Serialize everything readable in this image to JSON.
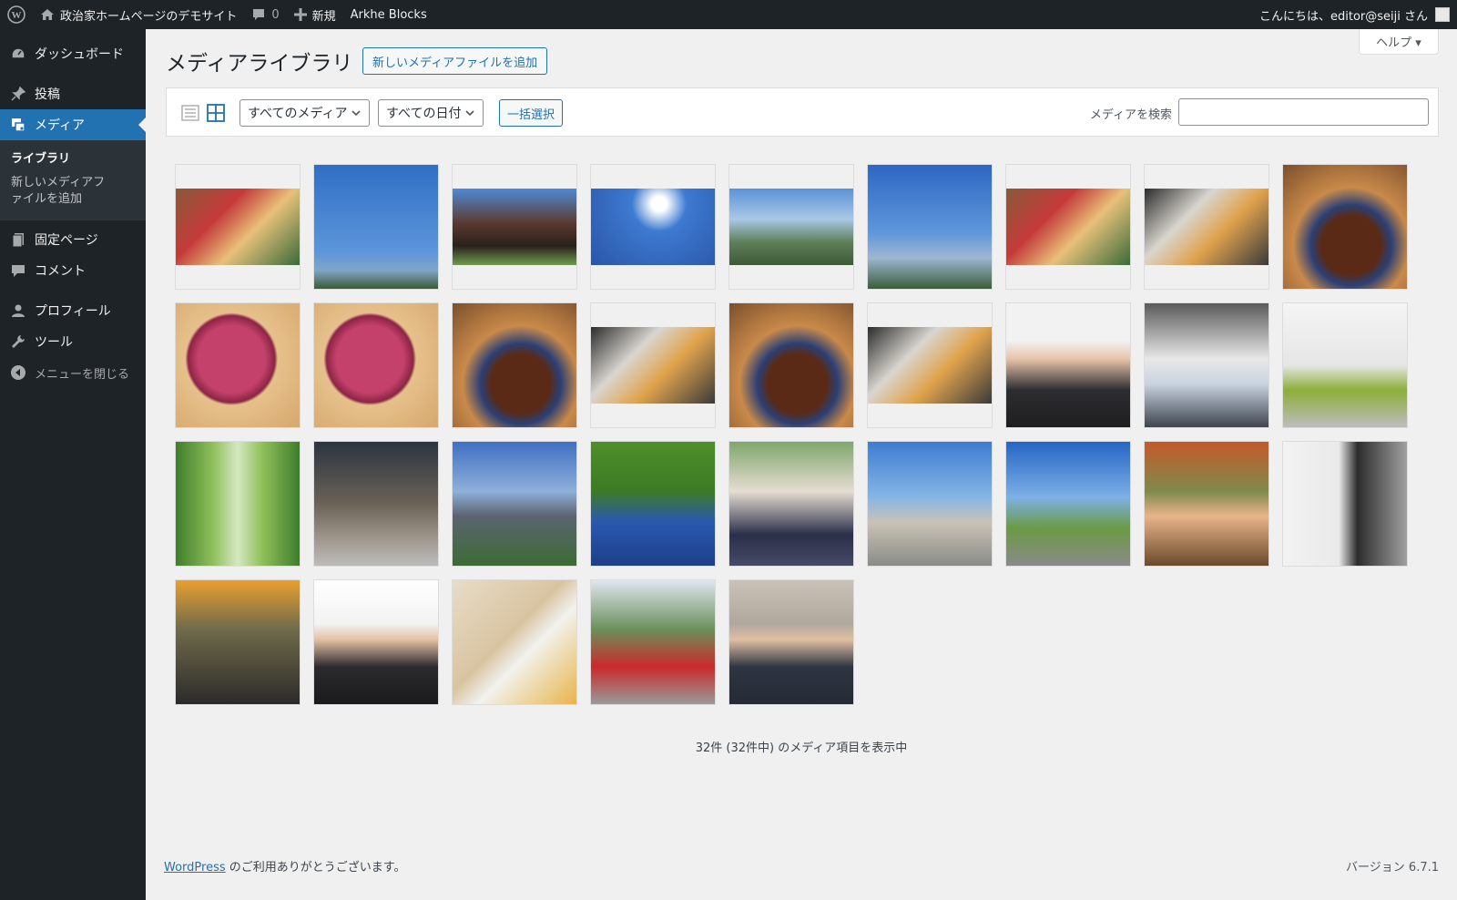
{
  "adminbar": {
    "site_name": "政治家ホームページのデモサイト",
    "comments_count": "0",
    "new_label": "新規",
    "theme_link": "Arkhe Blocks",
    "greeting": "こんにちは、editor@seiji さん"
  },
  "sidebar": {
    "items": [
      {
        "label": "ダッシュボード",
        "icon": "dashboard-icon"
      },
      {
        "label": "投稿",
        "icon": "pin-icon"
      },
      {
        "label": "メディア",
        "icon": "media-icon"
      },
      {
        "label": "固定ページ",
        "icon": "page-icon"
      },
      {
        "label": "コメント",
        "icon": "comment-icon"
      },
      {
        "label": "プロフィール",
        "icon": "user-icon"
      },
      {
        "label": "ツール",
        "icon": "wrench-icon"
      }
    ],
    "submenu": {
      "library": "ライブラリ",
      "add_new": "新しいメディアファイルを追加"
    },
    "collapse_label": "メニューを閉じる"
  },
  "header": {
    "title": "メディアライブラリ",
    "add_new_button": "新しいメディアファイルを追加",
    "help_label": "ヘルプ ▾"
  },
  "toolbar": {
    "type_filter": "すべてのメディア",
    "date_filter": "すべての日付",
    "bulk_select": "一括選択",
    "search_label": "メディアを検索",
    "search_value": ""
  },
  "media": [
    {
      "subject": "gift boxes",
      "fit": "band"
    },
    {
      "subject": "blue sky",
      "fit": "full"
    },
    {
      "subject": "curved monument",
      "fit": "band"
    },
    {
      "subject": "sun sculpture",
      "fit": "band"
    },
    {
      "subject": "mountain statues",
      "fit": "band"
    },
    {
      "subject": "sea of clouds",
      "fit": "full"
    },
    {
      "subject": "gift boxes",
      "fit": "band"
    },
    {
      "subject": "cafe toast",
      "fit": "band"
    },
    {
      "subject": "grilled meat plate",
      "fit": "full"
    },
    {
      "subject": "red apple",
      "fit": "full"
    },
    {
      "subject": "red apple",
      "fit": "full"
    },
    {
      "subject": "grilled meat plate",
      "fit": "full"
    },
    {
      "subject": "cafe toast",
      "fit": "band"
    },
    {
      "subject": "grilled meat plate",
      "fit": "full"
    },
    {
      "subject": "cafe toast",
      "fit": "band"
    },
    {
      "subject": "businessman portrait",
      "fit": "full"
    },
    {
      "subject": "man with phone",
      "fit": "full"
    },
    {
      "subject": "white building",
      "fit": "full"
    },
    {
      "subject": "greenhouse tomatoes",
      "fit": "full"
    },
    {
      "subject": "office building",
      "fit": "full"
    },
    {
      "subject": "modern architecture",
      "fit": "full"
    },
    {
      "subject": "solar panels",
      "fit": "full"
    },
    {
      "subject": "students",
      "fit": "full"
    },
    {
      "subject": "city bay",
      "fit": "full"
    },
    {
      "subject": "cyclist",
      "fit": "full"
    },
    {
      "subject": "picnic",
      "fit": "full"
    },
    {
      "subject": "kitchen",
      "fit": "full"
    },
    {
      "subject": "camping",
      "fit": "full"
    },
    {
      "subject": "businessman pointing",
      "fit": "full"
    },
    {
      "subject": "beach cleanup",
      "fit": "full"
    },
    {
      "subject": "fire drill",
      "fit": "full"
    },
    {
      "subject": "businessman arms crossed",
      "fit": "full"
    }
  ],
  "count_text": "32件 (32件中) のメディア項目を表示中",
  "footer": {
    "wp_link": "WordPress",
    "thanks": " のご利用ありがとうございます。",
    "version": "バージョン 6.7.1"
  },
  "colors": {
    "admin_dark": "#1d2327",
    "accent": "#2271b1",
    "bg": "#f0f0f1"
  }
}
